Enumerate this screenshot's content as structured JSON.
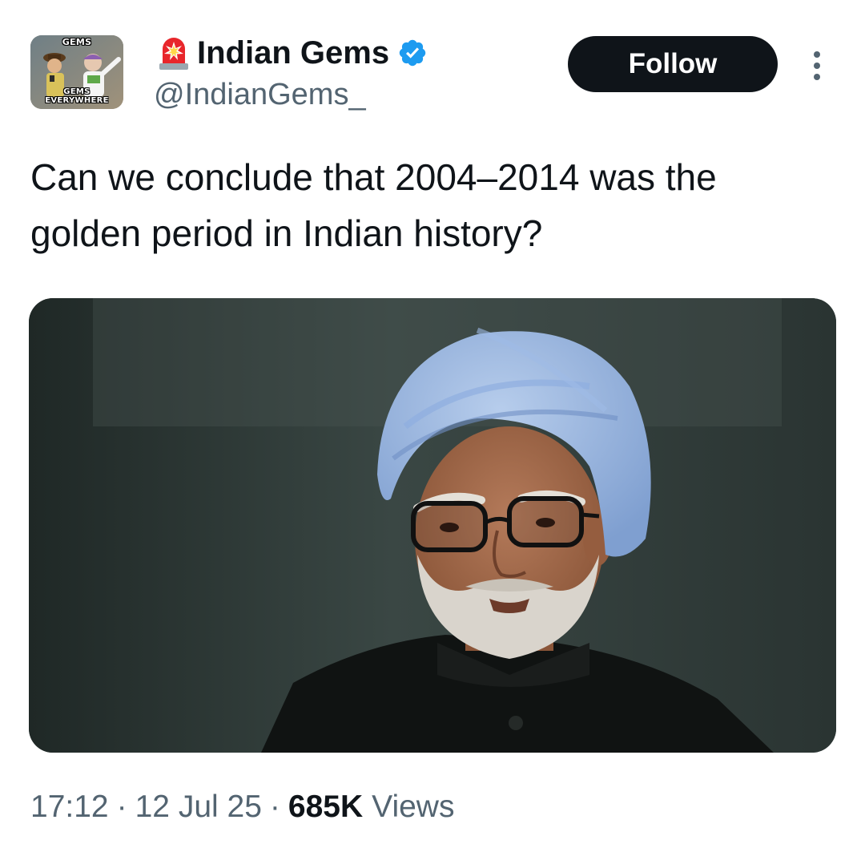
{
  "author": {
    "display_name": "Indian Gems",
    "handle": "@IndianGems_",
    "avatar_caption_top": "GEMS",
    "avatar_caption_bottom": "GEMS EVERYWHERE",
    "verified": true,
    "emoji_icon": "police-siren-icon"
  },
  "actions": {
    "follow_label": "Follow"
  },
  "tweet": {
    "text": "Can we conclude that 2004–2014 was the golden period in Indian history?",
    "photo_icon": "portrait-photo"
  },
  "meta": {
    "time": "17:12",
    "separator": "·",
    "date": "12 Jul 25",
    "views_count": "685K",
    "views_label": "Views"
  },
  "colors": {
    "text_primary": "#0f1419",
    "text_secondary": "#536471",
    "verified_blue": "#1d9bf0",
    "button_bg": "#0f1419"
  }
}
